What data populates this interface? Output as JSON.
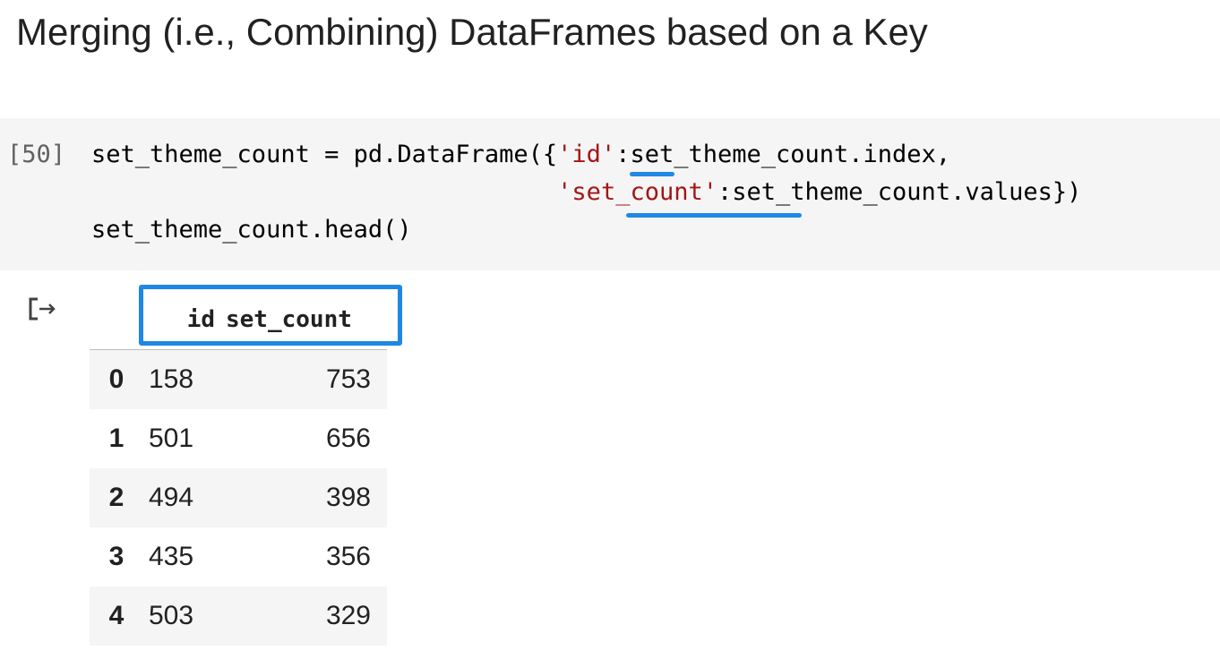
{
  "heading": "Merging (i.e., Combining) DataFrames based on a Key",
  "cell": {
    "execution_count": "[50]",
    "code_lines": [
      {
        "pre": "set_theme_count = pd.DataFrame({",
        "str": "'id'",
        "post": ":set_theme_count.index,"
      },
      {
        "pre": "                                ",
        "str": "'set_count'",
        "post": ":set_theme_count.values})"
      },
      {
        "pre": "set_theme_count.head()",
        "str": "",
        "post": ""
      }
    ]
  },
  "output": {
    "icon": "output-redirect-icon",
    "table": {
      "columns": [
        "",
        "id",
        "set_count"
      ],
      "rows": [
        {
          "index": "0",
          "id": "158",
          "set_count": "753"
        },
        {
          "index": "1",
          "id": "501",
          "set_count": "656"
        },
        {
          "index": "2",
          "id": "494",
          "set_count": "398"
        },
        {
          "index": "3",
          "id": "435",
          "set_count": "356"
        },
        {
          "index": "4",
          "id": "503",
          "set_count": "329"
        }
      ]
    }
  },
  "colors": {
    "annotation_blue": "#1e88e5",
    "string_red": "#a31515",
    "cell_background": "#f5f5f5"
  }
}
